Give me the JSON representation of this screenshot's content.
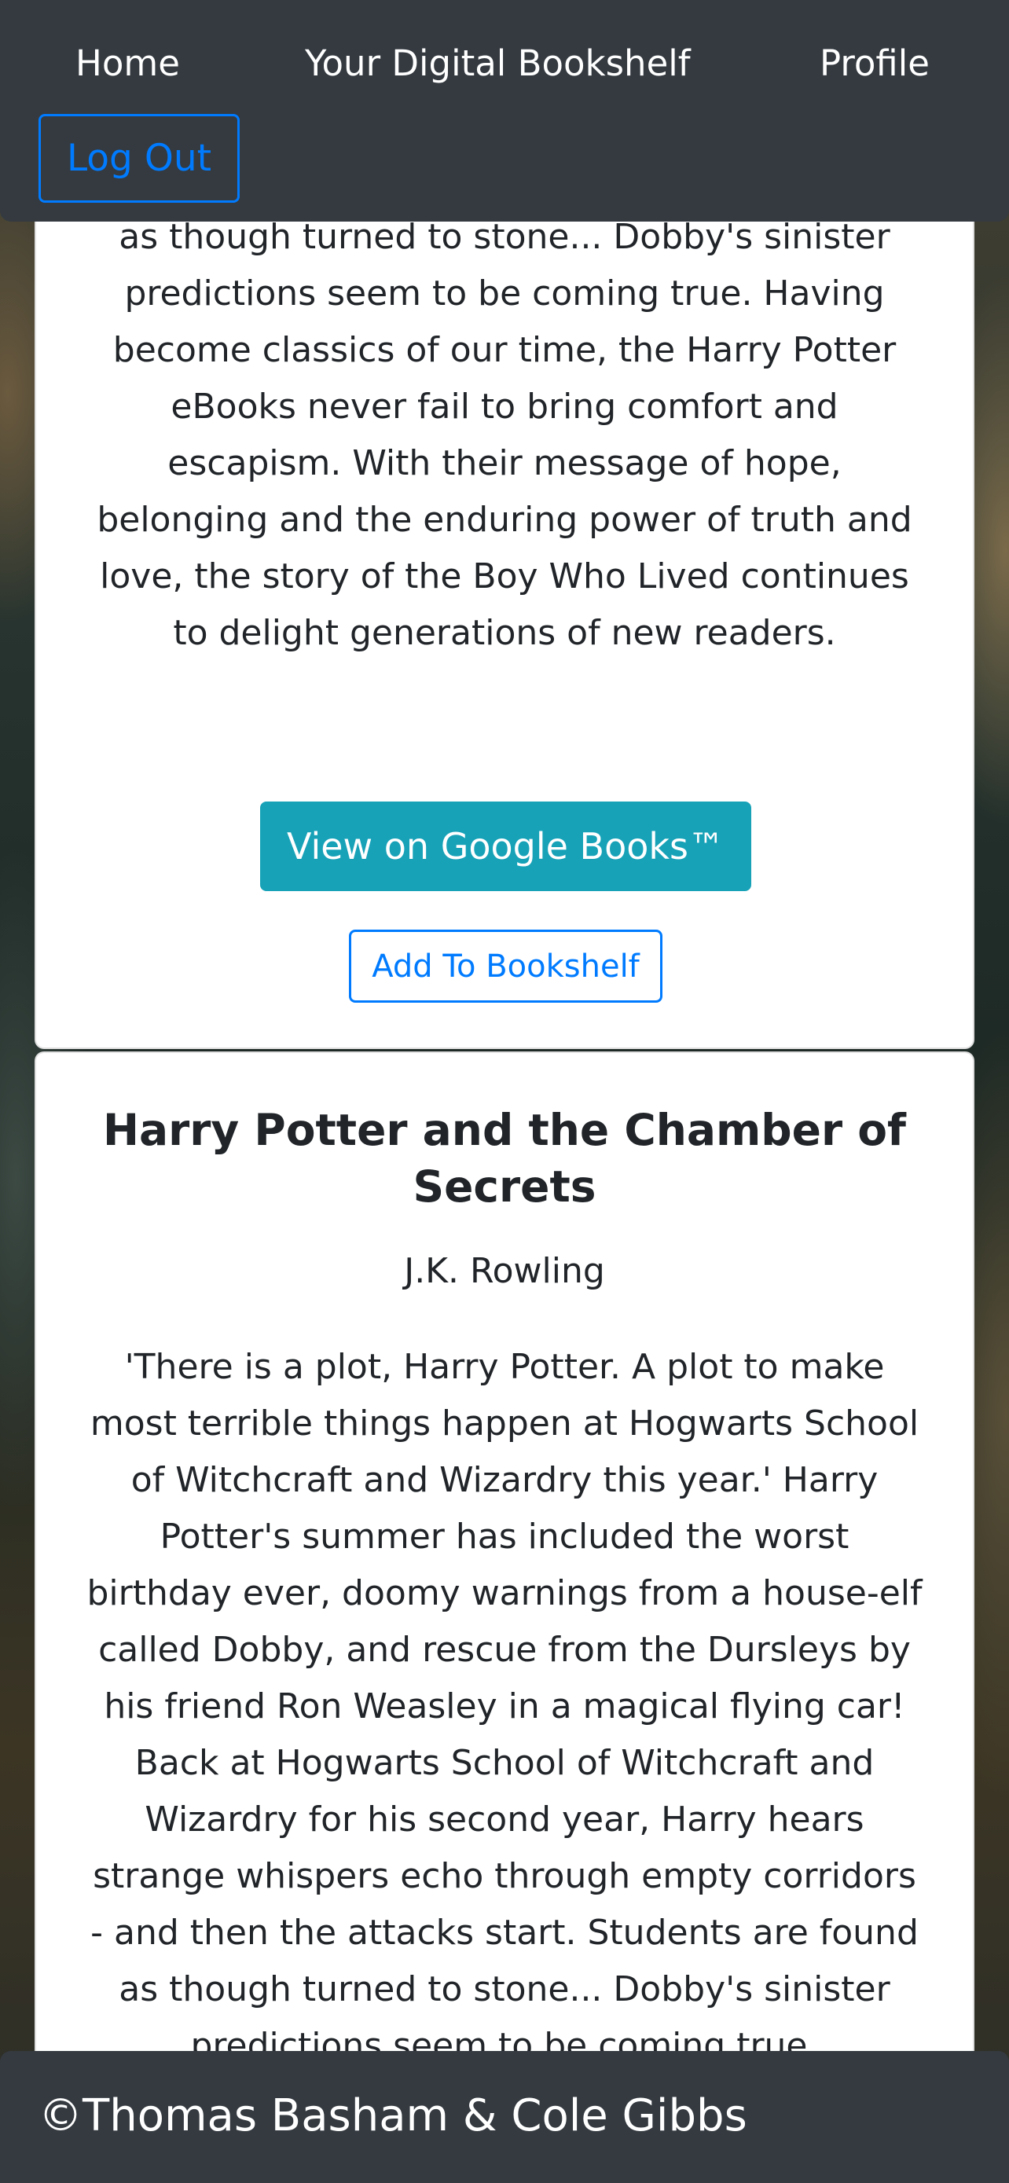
{
  "nav": {
    "home": "Home",
    "bookshelf": "Your Digital Bookshelf",
    "profile": "Profile",
    "logout": "Log Out"
  },
  "books": [
    {
      "description_visible": "strange whispers echo through empty corridors - and then the attacks start. Students are found as though turned to stone... Dobby's sinister predictions seem to be coming true. Having become classics of our time, the Harry Potter eBooks never fail to bring comfort and escapism. With their message of hope, belonging and the enduring power of truth and love, the story of the Boy Who Lived continues to delight generations of new readers.",
      "google_button": "View on Google Books™",
      "add_button": "Add To Bookshelf"
    },
    {
      "title": "Harry Potter and the Chamber of Secrets",
      "author": "J.K. Rowling",
      "description_visible": "'There is a plot, Harry Potter. A plot to make most terrible things happen at Hogwarts School of Witchcraft and Wizardry this year.' Harry Potter's summer has included the worst birthday ever, doomy warnings from a house-elf called Dobby, and rescue from the Dursleys by his friend Ron Weasley in a magical flying car! Back at Hogwarts School of Witchcraft and Wizardry for his second year, Harry hears strange whispers echo through empty corridors - and then the attacks start. Students are found as though turned to stone... Dobby's sinister predictions seem to be coming true."
    }
  ],
  "footer": {
    "text": "©Thomas Basham & Cole Gibbs"
  }
}
